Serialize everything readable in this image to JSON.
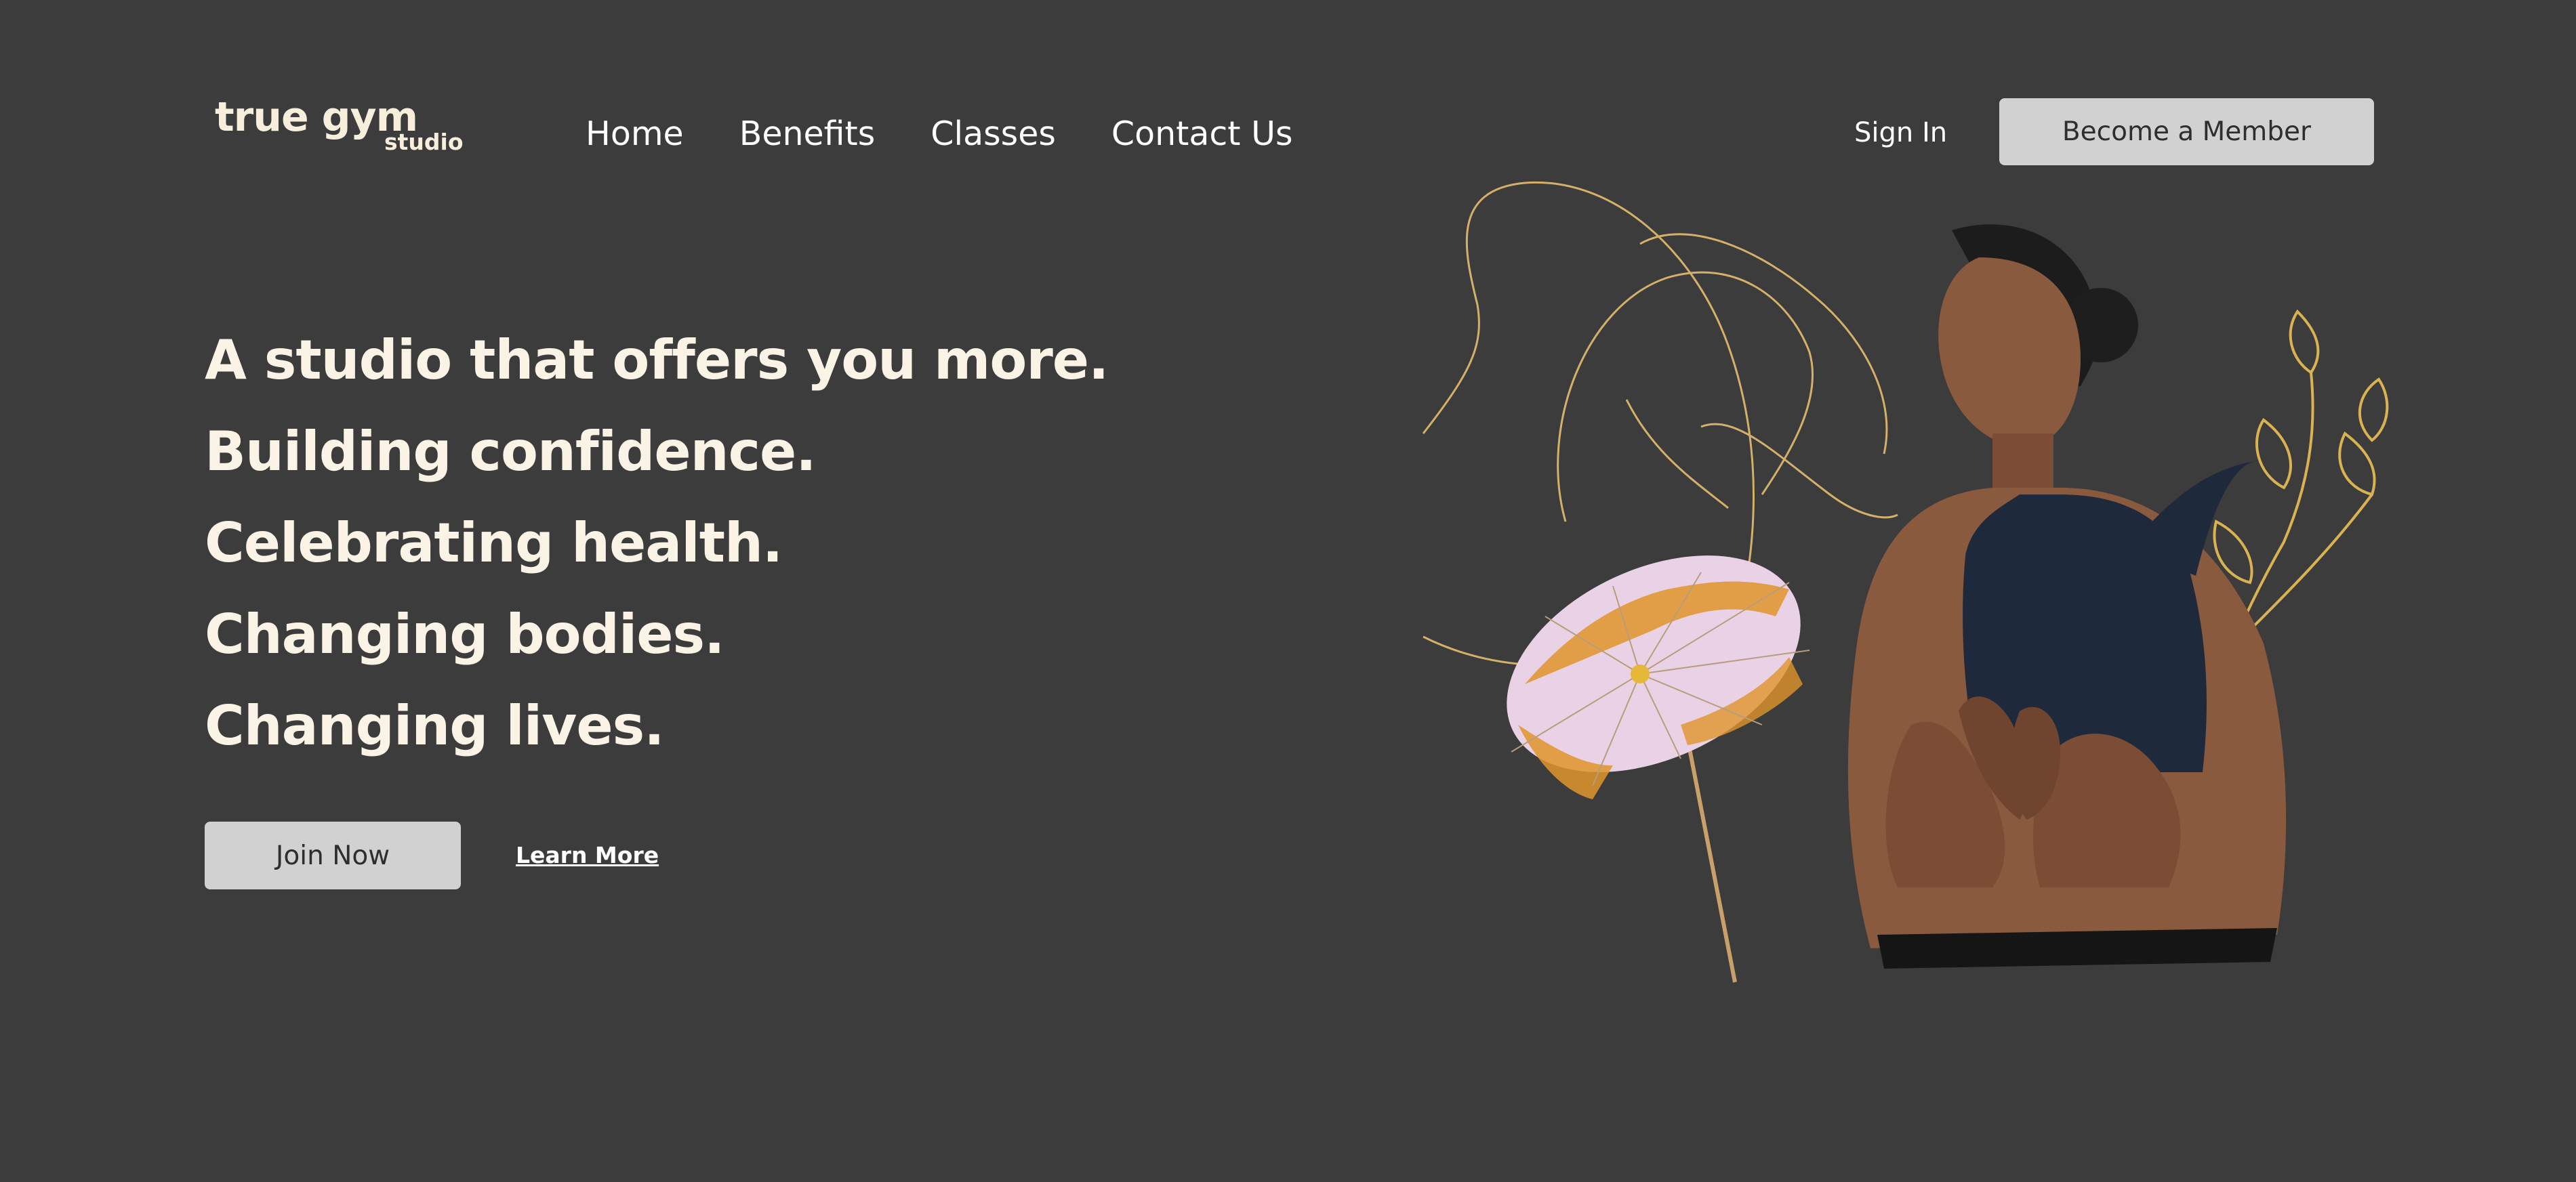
{
  "brand": {
    "logo_main": "true gym",
    "logo_sub": "studio"
  },
  "nav": {
    "items": [
      "Home",
      "Benefits",
      "Classes",
      "Contact Us"
    ],
    "sign_in": "Sign In",
    "cta": "Become a Member"
  },
  "hero": {
    "headline_lines": [
      "A studio that offers you more.",
      "Building confidence.",
      "Celebrating health.",
      "Changing bodies.",
      "Changing lives."
    ],
    "primary_button": "Join Now",
    "secondary_link": "Learn More"
  },
  "colors": {
    "background": "#3c3c3c",
    "headline": "#fbf4e6",
    "button_bg": "#d1d1d1",
    "button_text": "#2e2e2e",
    "gold_line": "#d4b06a",
    "petal_pink": "#e9c9e4",
    "petal_orange": "#e0952a",
    "sports_top": "#1e2a3c",
    "skin": "#8a5a3e"
  }
}
